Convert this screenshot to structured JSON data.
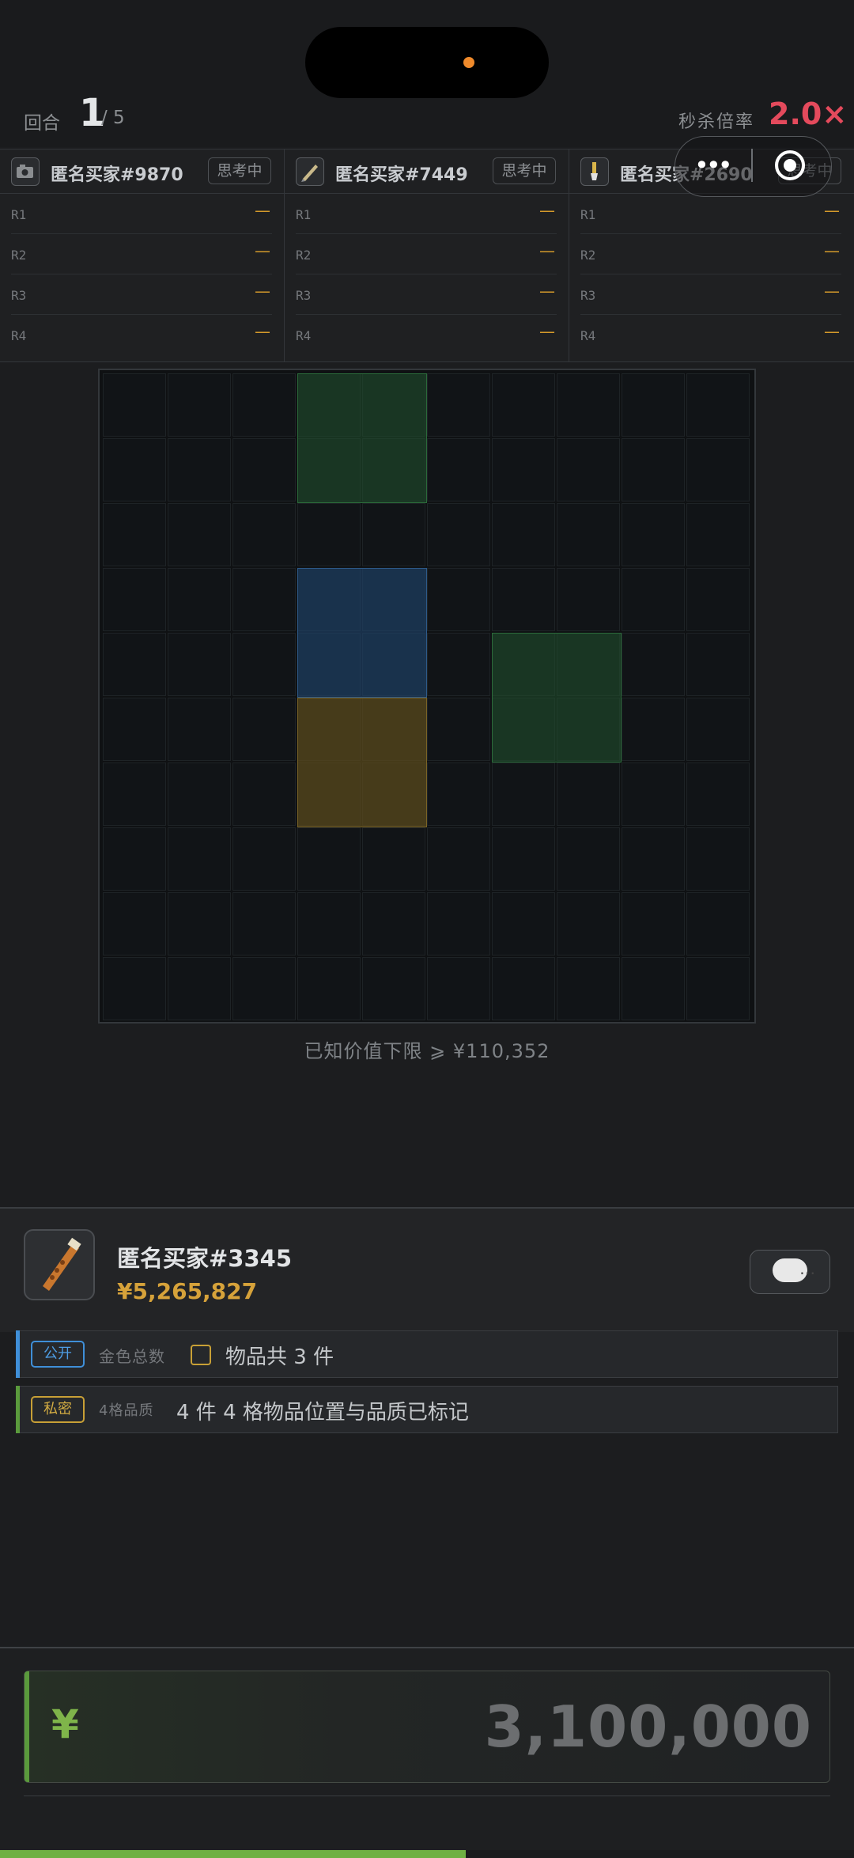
{
  "header": {
    "round_label": "回合",
    "round_current": "1",
    "round_total": "/ 5",
    "rate_label": "秒杀倍率",
    "rate_value": "2.0×"
  },
  "capsule": {
    "more_icon": "•••",
    "target_icon": "target-icon"
  },
  "buyers": [
    {
      "name": "匿名买家#9870",
      "status": "思考中",
      "avatar_icon": "camera-icon",
      "rounds": [
        {
          "label": "R1",
          "value": "—"
        },
        {
          "label": "R2",
          "value": "—"
        },
        {
          "label": "R3",
          "value": "—"
        },
        {
          "label": "R4",
          "value": "—"
        }
      ]
    },
    {
      "name": "匿名买家#7449",
      "status": "思考中",
      "avatar_icon": "pen-icon",
      "rounds": [
        {
          "label": "R1",
          "value": "—"
        },
        {
          "label": "R2",
          "value": "—"
        },
        {
          "label": "R3",
          "value": "—"
        },
        {
          "label": "R4",
          "value": "—"
        }
      ]
    },
    {
      "name": "匿名买家#2690",
      "status": "思考中",
      "avatar_icon": "brush-icon",
      "rounds": [
        {
          "label": "R1",
          "value": "—"
        },
        {
          "label": "R2",
          "value": "—"
        },
        {
          "label": "R3",
          "value": "—"
        },
        {
          "label": "R4",
          "value": "—"
        }
      ]
    }
  ],
  "grid": {
    "rows": 10,
    "cols": 10,
    "items": [
      {
        "quality": "green",
        "row": 0,
        "col": 3,
        "w": 2,
        "h": 2
      },
      {
        "quality": "blue",
        "row": 3,
        "col": 3,
        "w": 2,
        "h": 2
      },
      {
        "quality": "green",
        "row": 4,
        "col": 6,
        "w": 2,
        "h": 2
      },
      {
        "quality": "gold",
        "row": 5,
        "col": 3,
        "w": 2,
        "h": 2
      }
    ]
  },
  "known_value": "已知价值下限 ⩾ ¥110,352",
  "self": {
    "name": "匿名买家#3345",
    "money": "¥5,265,827",
    "avatar_icon": "flute-icon",
    "chat_icon": "chat-bubble-icon"
  },
  "clues": [
    {
      "tag": "公开",
      "type": "金色总数",
      "text": "物品共 3 件"
    },
    {
      "tag": "私密",
      "type": "4格品质",
      "text": "4 件 4 格物品位置与品质已标记"
    }
  ],
  "bid": {
    "currency": "¥",
    "value": "3,100,000",
    "progress": 0.545
  },
  "colors": {
    "accent_red": "#e44a5c",
    "gold": "#d6a23a",
    "public_blue": "#3f8fd8",
    "private_gold": "#c8a036",
    "progress_green": "#6fb043"
  }
}
